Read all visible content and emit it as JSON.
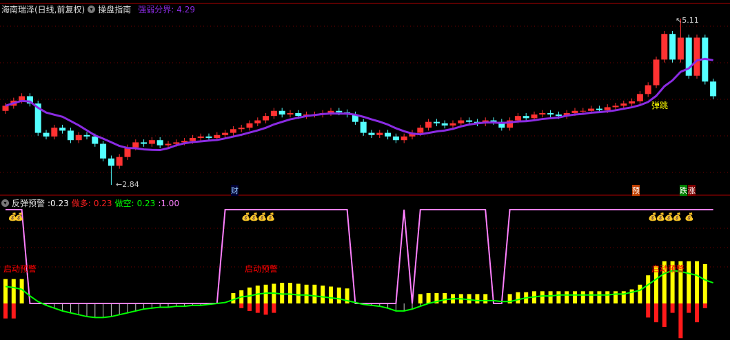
{
  "header": {
    "stock": "海南瑞泽(日线,前复权)",
    "indicator": "操盘指南",
    "boundary_label": "强弱分界:",
    "boundary_value": "4.29"
  },
  "sub_header": {
    "name": "反弹预警",
    "value": ":0.23",
    "long_label": "做多:",
    "long_value": "0.23",
    "short_label": "做空:",
    "short_value": "0.23",
    "ratio": ":1.00"
  },
  "colors": {
    "up": "#ff3232",
    "down": "#54ffff",
    "ma": "#8a2be2",
    "pink": "#ff80ff",
    "green": "#00ff00",
    "yellow": "#ffff00",
    "grid": "#7a0000"
  },
  "annotations": {
    "low": "2.84",
    "high": "5.11",
    "bounce": "弹跳",
    "cai": "财",
    "yu": "预",
    "die": "跌",
    "zhang": "涨",
    "alert": "启动预警"
  },
  "chart_data": {
    "type": "candlestick",
    "price_range": [
      2.84,
      5.11
    ],
    "close": [
      3.92,
      3.99,
      4.05,
      3.95,
      3.55,
      3.5,
      3.62,
      3.58,
      3.45,
      3.52,
      3.5,
      3.4,
      3.2,
      3.1,
      3.22,
      3.35,
      3.42,
      3.4,
      3.45,
      3.38,
      3.4,
      3.42,
      3.44,
      3.48,
      3.5,
      3.48,
      3.52,
      3.55,
      3.6,
      3.62,
      3.68,
      3.72,
      3.78,
      3.85,
      3.8,
      3.82,
      3.78,
      3.8,
      3.8,
      3.82,
      3.85,
      3.83,
      3.8,
      3.7,
      3.55,
      3.52,
      3.55,
      3.5,
      3.45,
      3.5,
      3.55,
      3.62,
      3.7,
      3.68,
      3.65,
      3.68,
      3.72,
      3.7,
      3.68,
      3.72,
      3.7,
      3.62,
      3.72,
      3.78,
      3.75,
      3.8,
      3.82,
      3.8,
      3.78,
      3.82,
      3.85,
      3.85,
      3.88,
      3.86,
      3.9,
      3.92,
      3.95,
      3.98,
      4.08,
      4.2,
      4.55,
      4.9,
      4.55,
      4.85,
      4.33,
      4.85,
      4.25,
      4.05
    ],
    "first_open": 3.85,
    "wick": 0.04,
    "special": {
      "low_index": 13,
      "low": 2.84,
      "high_index": 83,
      "high": 5.11
    },
    "ma_period": 8,
    "pink_state": [
      1,
      1,
      1,
      0,
      0,
      0,
      0,
      0,
      0,
      0,
      0,
      0,
      0,
      0,
      0,
      0,
      0,
      0,
      0,
      0,
      0,
      0,
      0,
      0,
      0,
      0,
      0,
      1,
      1,
      1,
      1,
      1,
      1,
      1,
      1,
      1,
      1,
      1,
      1,
      1,
      1,
      1,
      1,
      0,
      0,
      0,
      0,
      0,
      0,
      1,
      0,
      1,
      1,
      1,
      1,
      1,
      1,
      1,
      1,
      1,
      0,
      0,
      1,
      1,
      1,
      1,
      1,
      1,
      1,
      1,
      1,
      1,
      1,
      1,
      1,
      1,
      1,
      1,
      1,
      1,
      1,
      1,
      1,
      1,
      1,
      1,
      1,
      1
    ],
    "green": [
      0.18,
      0.17,
      0.15,
      0.08,
      0.02,
      -0.02,
      -0.05,
      -0.08,
      -0.1,
      -0.12,
      -0.14,
      -0.15,
      -0.15,
      -0.14,
      -0.12,
      -0.1,
      -0.08,
      -0.06,
      -0.05,
      -0.04,
      -0.04,
      -0.03,
      -0.03,
      -0.02,
      -0.02,
      -0.01,
      0,
      0.01,
      0.04,
      0.07,
      0.08,
      0.1,
      0.11,
      0.11,
      0.1,
      0.1,
      0.09,
      0.09,
      0.08,
      0.07,
      0.06,
      0.05,
      0.03,
      0.01,
      -0.01,
      -0.02,
      -0.03,
      -0.05,
      -0.08,
      -0.08,
      -0.06,
      -0.03,
      0,
      0.02,
      0.04,
      0.05,
      0.05,
      0.04,
      0.03,
      0.03,
      0.03,
      0.02,
      0.02,
      0.04,
      0.06,
      0.07,
      0.08,
      0.08,
      0.09,
      0.09,
      0.09,
      0.09,
      0.09,
      0.09,
      0.09,
      0.1,
      0.1,
      0.12,
      0.14,
      0.2,
      0.26,
      0.32,
      0.35,
      0.34,
      0.32,
      0.3,
      0.25,
      0.22
    ],
    "yellow": [
      0.26,
      0.26,
      0.26,
      0,
      0,
      0,
      0,
      0,
      0,
      0,
      0,
      0,
      0,
      0,
      0,
      0,
      0,
      0,
      0,
      0,
      0,
      0,
      0,
      0,
      0,
      0,
      0,
      0,
      0.11,
      0.14,
      0.17,
      0.19,
      0.2,
      0.21,
      0.22,
      0.22,
      0.21,
      0.2,
      0.2,
      0.19,
      0.18,
      0.17,
      0.16,
      0,
      0,
      0,
      0,
      0,
      0,
      0,
      0,
      0.1,
      0.11,
      0.11,
      0.11,
      0.1,
      0.1,
      0.1,
      0.1,
      0.1,
      0,
      0,
      0.1,
      0.12,
      0.12,
      0.13,
      0.13,
      0.13,
      0.13,
      0.13,
      0.13,
      0.13,
      0.13,
      0.13,
      0.13,
      0.13,
      0.13,
      0.15,
      0.2,
      0.3,
      0.4,
      0.45,
      0.45,
      0.45,
      0.45,
      0.45,
      0.42,
      0
    ],
    "red": [
      -0.16,
      -0.16,
      0,
      0,
      0,
      0,
      0,
      0,
      0,
      0,
      0,
      0,
      0,
      0,
      0,
      0,
      0,
      0,
      0,
      0,
      0,
      0,
      0,
      0,
      0,
      0,
      0,
      0,
      0,
      -0.05,
      -0.08,
      -0.1,
      -0.12,
      -0.1,
      0,
      0,
      0,
      0,
      0,
      0,
      0,
      0,
      0,
      0,
      0,
      0,
      0,
      0,
      0,
      0,
      0,
      0,
      0,
      0,
      0,
      0,
      0,
      0,
      0,
      0,
      0,
      0,
      0,
      0,
      0,
      0,
      0,
      0,
      0,
      0,
      0,
      0,
      0,
      0,
      0,
      0,
      0,
      0,
      0,
      -0.15,
      -0.2,
      -0.25,
      -0.1,
      -0.37,
      -0.1,
      -0.2,
      -0.05,
      0
    ]
  }
}
